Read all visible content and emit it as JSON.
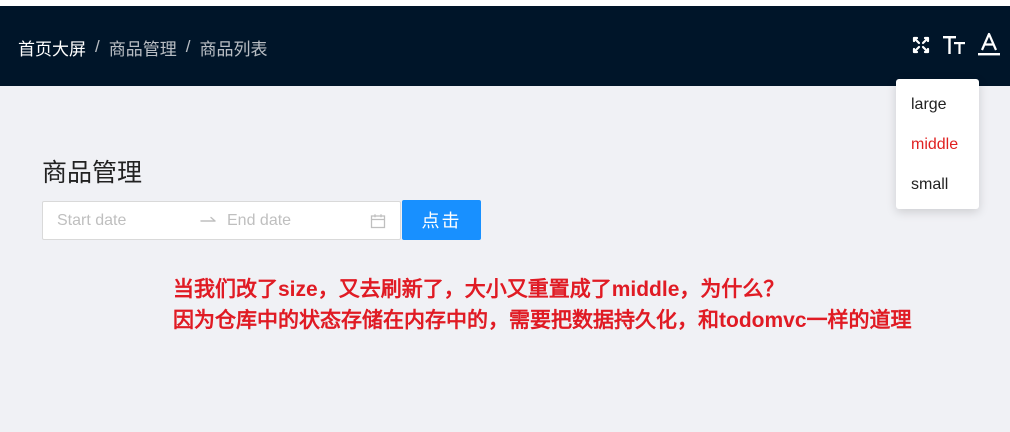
{
  "breadcrumb": {
    "items": [
      "首页大屏",
      "商品管理",
      "商品列表"
    ],
    "separator": "/"
  },
  "header_icons": [
    "fullscreen-icon",
    "font-size-icon",
    "font-color-icon"
  ],
  "size_menu": {
    "options": [
      "large",
      "middle",
      "small"
    ],
    "selected": "middle"
  },
  "main": {
    "title": "商品管理",
    "range_picker": {
      "start_placeholder": "Start date",
      "end_placeholder": "End date"
    },
    "button_label": "点击"
  },
  "annotation": {
    "line1": "当我们改了size，又去刷新了，大小又重置成了middle，为什么？",
    "line2": "因为仓库中的状态存储在内存中的，需要把数据持久化，和todomvc一样的道理"
  },
  "colors": {
    "header_bg": "#001529",
    "page_bg": "#f0f1f5",
    "primary": "#1890ff",
    "annotation": "#e01b24",
    "selected_option": "#e02020"
  }
}
